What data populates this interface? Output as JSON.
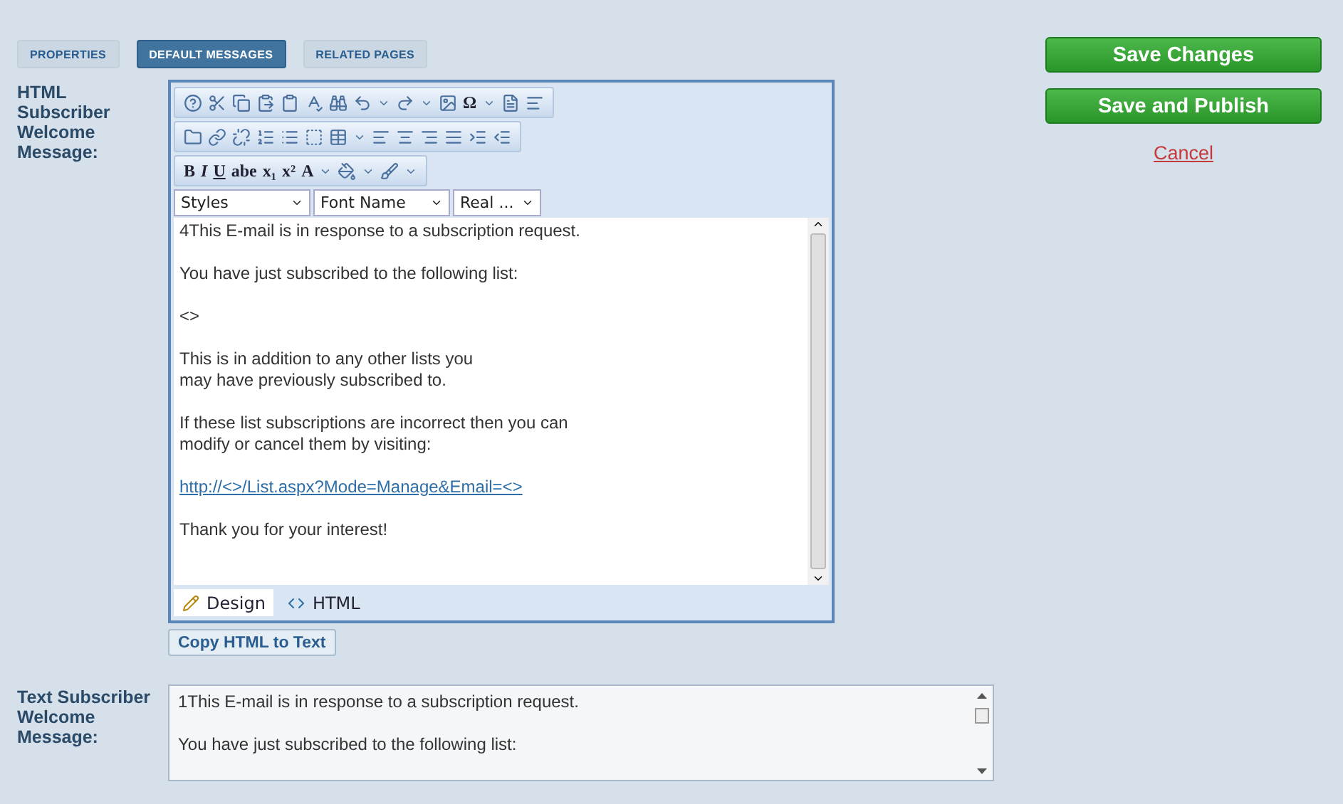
{
  "tabs": [
    {
      "label": "PROPERTIES",
      "selected": false
    },
    {
      "label": "DEFAULT MESSAGES",
      "selected": true
    },
    {
      "label": "RELATED PAGES",
      "selected": false
    }
  ],
  "html_field": {
    "label": "HTML Subscriber Welcome Message:",
    "glyphs": [
      "Ω",
      "B",
      "I",
      "U",
      "abe",
      "x₁",
      "x²",
      "A"
    ],
    "dropdowns": [
      "Styles",
      "Font Name",
      "Real ..."
    ],
    "content": [
      {
        "kind": "line",
        "text": "4This E-mail is in response to a subscription request."
      },
      {
        "kind": "line",
        "text": "You have just subscribed to the following list:"
      },
      {
        "kind": "line",
        "text": "<>"
      },
      {
        "kind": "line",
        "text": "This is in addition to any other lists you\nmay have previously subscribed to."
      },
      {
        "kind": "line",
        "text": "If these list subscriptions are incorrect then you can\nmodify or cancel them by visiting:"
      },
      {
        "kind": "link",
        "text": "http://<>/List.aspx?Mode=Manage&Email=<>"
      },
      {
        "kind": "line",
        "text": "Thank you for your interest!"
      }
    ],
    "modes": [
      {
        "label": "Design",
        "selected": true
      },
      {
        "label": "HTML",
        "selected": false
      }
    ],
    "copy_button": "Copy HTML to Text"
  },
  "text_field": {
    "label": "Text Subscriber Welcome Message:",
    "lines": [
      "1This E-mail is in response to a subscription request.",
      "You have just subscribed to the following list:"
    ]
  },
  "actions": {
    "save": "Save Changes",
    "publish": "Save and Publish",
    "cancel": "Cancel"
  }
}
